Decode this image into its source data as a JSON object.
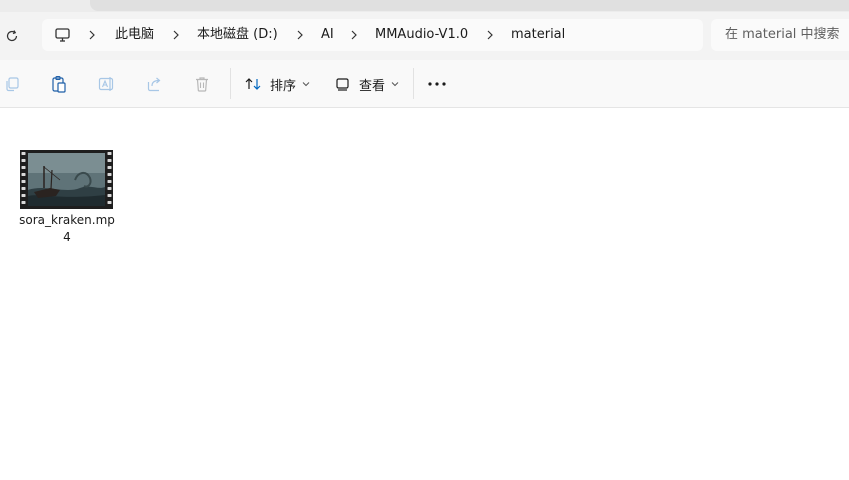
{
  "address_bar": {
    "breadcrumbs": [
      "此电脑",
      "本地磁盘 (D:)",
      "AI",
      "MMAudio-V1.0",
      "material"
    ],
    "root_icon": "computer-monitor-icon",
    "separator_icon": "chevron-right-icon"
  },
  "search": {
    "placeholder": "在 material 中搜索"
  },
  "toolbar": {
    "copy_icon": "copy-icon",
    "paste_icon": "paste-icon",
    "rename_icon": "rename-icon",
    "share_icon": "share-icon",
    "delete_icon": "delete-icon",
    "sort_label": "排序",
    "view_label": "查看",
    "more_icon": "more-icon"
  },
  "files": [
    {
      "name": "sora_kraken.mp4",
      "type": "video"
    }
  ],
  "colors": {
    "accent": "#0067c0",
    "disabled_icon": "#a8c7e6",
    "address_bg": "#f3f3f3"
  }
}
